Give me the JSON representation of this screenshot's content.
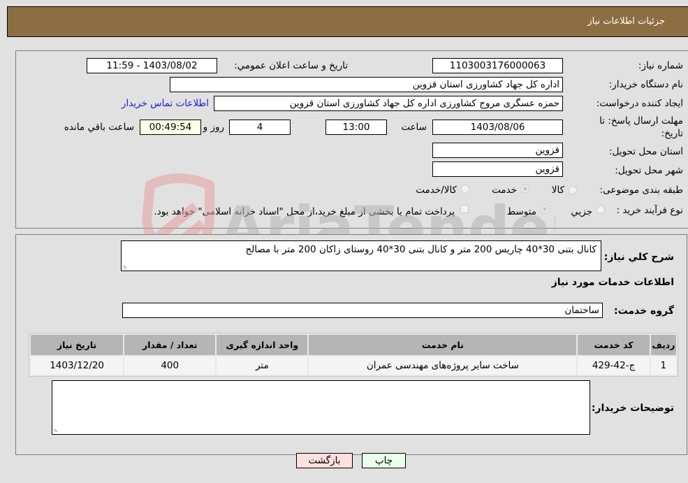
{
  "header": {
    "title": "جزئیات اطلاعات نیاز"
  },
  "details": {
    "need_number": {
      "label": "شماره نیاز:",
      "value": "1103003176000063"
    },
    "announce": {
      "label": "تاریخ و ساعت اعلان عمومي:",
      "value": "1403/08/02 - 11:59"
    },
    "buyer_org": {
      "label": "نام دستگاه خریدار:",
      "value": "اداره کل جهاد کشاورزی استان قزوین"
    },
    "requester": {
      "label": "ایجاد کننده درخواست:",
      "value": "حمزه عسگری مروج کشاورزی اداره کل جهاد کشاورزی استان قزوین",
      "contact_link": "اطلاعات تماس خریدار"
    },
    "deadline": {
      "label_line1": "مهلت ارسال پاسخ: تا",
      "label_line2": "تاریخ:",
      "date": "1403/08/06",
      "time_label": "ساعت",
      "time": "13:00",
      "days": "4",
      "days_label": "روز و",
      "remaining": "00:49:54",
      "remaining_label": "ساعت باقي مانده"
    },
    "province": {
      "label": "استان محل تحویل:",
      "value": "قزوین"
    },
    "city": {
      "label": "شهر محل تحویل:",
      "value": "قزوین"
    },
    "category": {
      "label": "طبقه بندی موضوعی:",
      "options": [
        "کالا",
        "خدمت",
        "کالا/خدمت"
      ],
      "selected": "خدمت"
    },
    "purchase_type": {
      "label": "نوع فرآیند خرید :",
      "options": [
        "جزیي",
        "متوسط"
      ],
      "selected": "متوسط",
      "treasury_note": "پرداخت تمام یا بخشی از مبلغ خرید،از محل \"اسناد خزانه اسلامی\" خواهد بود."
    }
  },
  "description": {
    "label": "شرح کلي نیاز:",
    "value": "کانال بتنی 30*40 چاریس 200 متر و کانال بتنی 30*40 روستای زاکان 200 متر با مصالح"
  },
  "services_section": {
    "title": "اطلاعات خدمات مورد نیاز",
    "group_label": "گروه خدمت:",
    "group_value": "ساختمان",
    "columns": [
      "ردیف",
      "کد خدمت",
      "نام خدمت",
      "واحد اندازه گیری",
      "تعداد / مقدار",
      "تاریخ نیاز"
    ],
    "rows": [
      [
        "1",
        "ج-42-429",
        "ساخت سایر پروژه‌های مهندسی عمران",
        "متر",
        "400",
        "1403/12/20"
      ]
    ]
  },
  "buyer_notes": {
    "label": "توضیحات خریدار:",
    "value": ""
  },
  "buttons": {
    "print": "چاپ",
    "back": "بازگشت"
  },
  "watermark": {
    "text": "AriaTender.neT"
  },
  "colors": {
    "header_bg": "#8d6e42",
    "print_bg": "#eaffea",
    "back_bg": "#ffe0e0",
    "link": "#1a1adc"
  }
}
